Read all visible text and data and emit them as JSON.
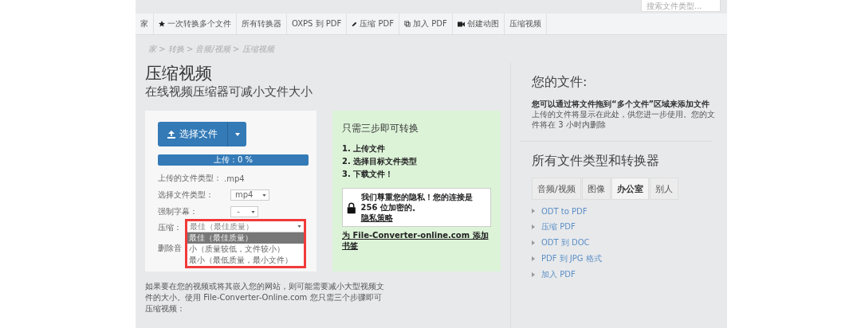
{
  "search": {
    "placeholder": "搜索文件类型..."
  },
  "nav": [
    "家",
    "一次转换多个文件",
    "所有转换器",
    "OXPS 到 PDF",
    "压缩 PDF",
    "加入 PDF",
    "创建动图",
    "压缩视频"
  ],
  "breadcrumb": "家 > 转换 > 音频/视频 > 压缩视频",
  "title": "压缩视频",
  "subtitle": "在线视频压缩器可减小文件大小",
  "upload": {
    "button": "选择文件",
    "progress": "上传：0 %",
    "fields": [
      {
        "kind": "text",
        "label": "上传的文件类型：",
        "value": ".mp4"
      },
      {
        "kind": "select",
        "label": "选择文件类型：",
        "value": "mp4"
      },
      {
        "kind": "select",
        "label": "强制字幕：",
        "value": "-"
      },
      {
        "kind": "dropdown",
        "label": "压缩：",
        "value": "最佳（最佳质量）",
        "expanded": true,
        "options": [
          {
            "label": "最佳（最佳质量）",
            "selected": true
          },
          {
            "label": "小（质量较低，文件较小）",
            "selected": false
          },
          {
            "label": "最小（最低质量，最小文件）",
            "selected": false
          }
        ]
      },
      {
        "kind": "text",
        "label": "删除音"
      }
    ]
  },
  "steps": {
    "title": "只需三步即可转换",
    "items": [
      "1. 上传文件",
      "2. 选择目标文件类型",
      "3. 下载文件！"
    ],
    "privacy": "我们尊重您的隐私！您的连接是 256 位加密的。",
    "privacy_link": "隐私策略",
    "bookmark": "为 File-Converter-online.com 添加书签"
  },
  "intro": "如果要在您的视频或将其嵌入您的网站，则可能需要减小大型视频文件的大小。使用 File-Converter-Online.com 您只需三个步骤即可压缩视频：",
  "files": {
    "title": "您的文件:",
    "bold": "您可以通过将文件拖到“多个文件”区域来添加文件",
    "text": "上传的文件将显示在此处，供您进一步使用。您的文件将在 3 小时内删除"
  },
  "converters": {
    "title": "所有文件类型和转换器",
    "tabs": [
      {
        "label": "音频/视频",
        "selected": false
      },
      {
        "label": "图像",
        "selected": false
      },
      {
        "label": "办公室",
        "selected": true
      },
      {
        "label": "别人",
        "selected": false
      }
    ],
    "links": [
      "ODT to PDF",
      "压缩 PDF",
      "ODT 到 DOC",
      "PDF 到 JPG 格式",
      "加入 PDF"
    ]
  }
}
